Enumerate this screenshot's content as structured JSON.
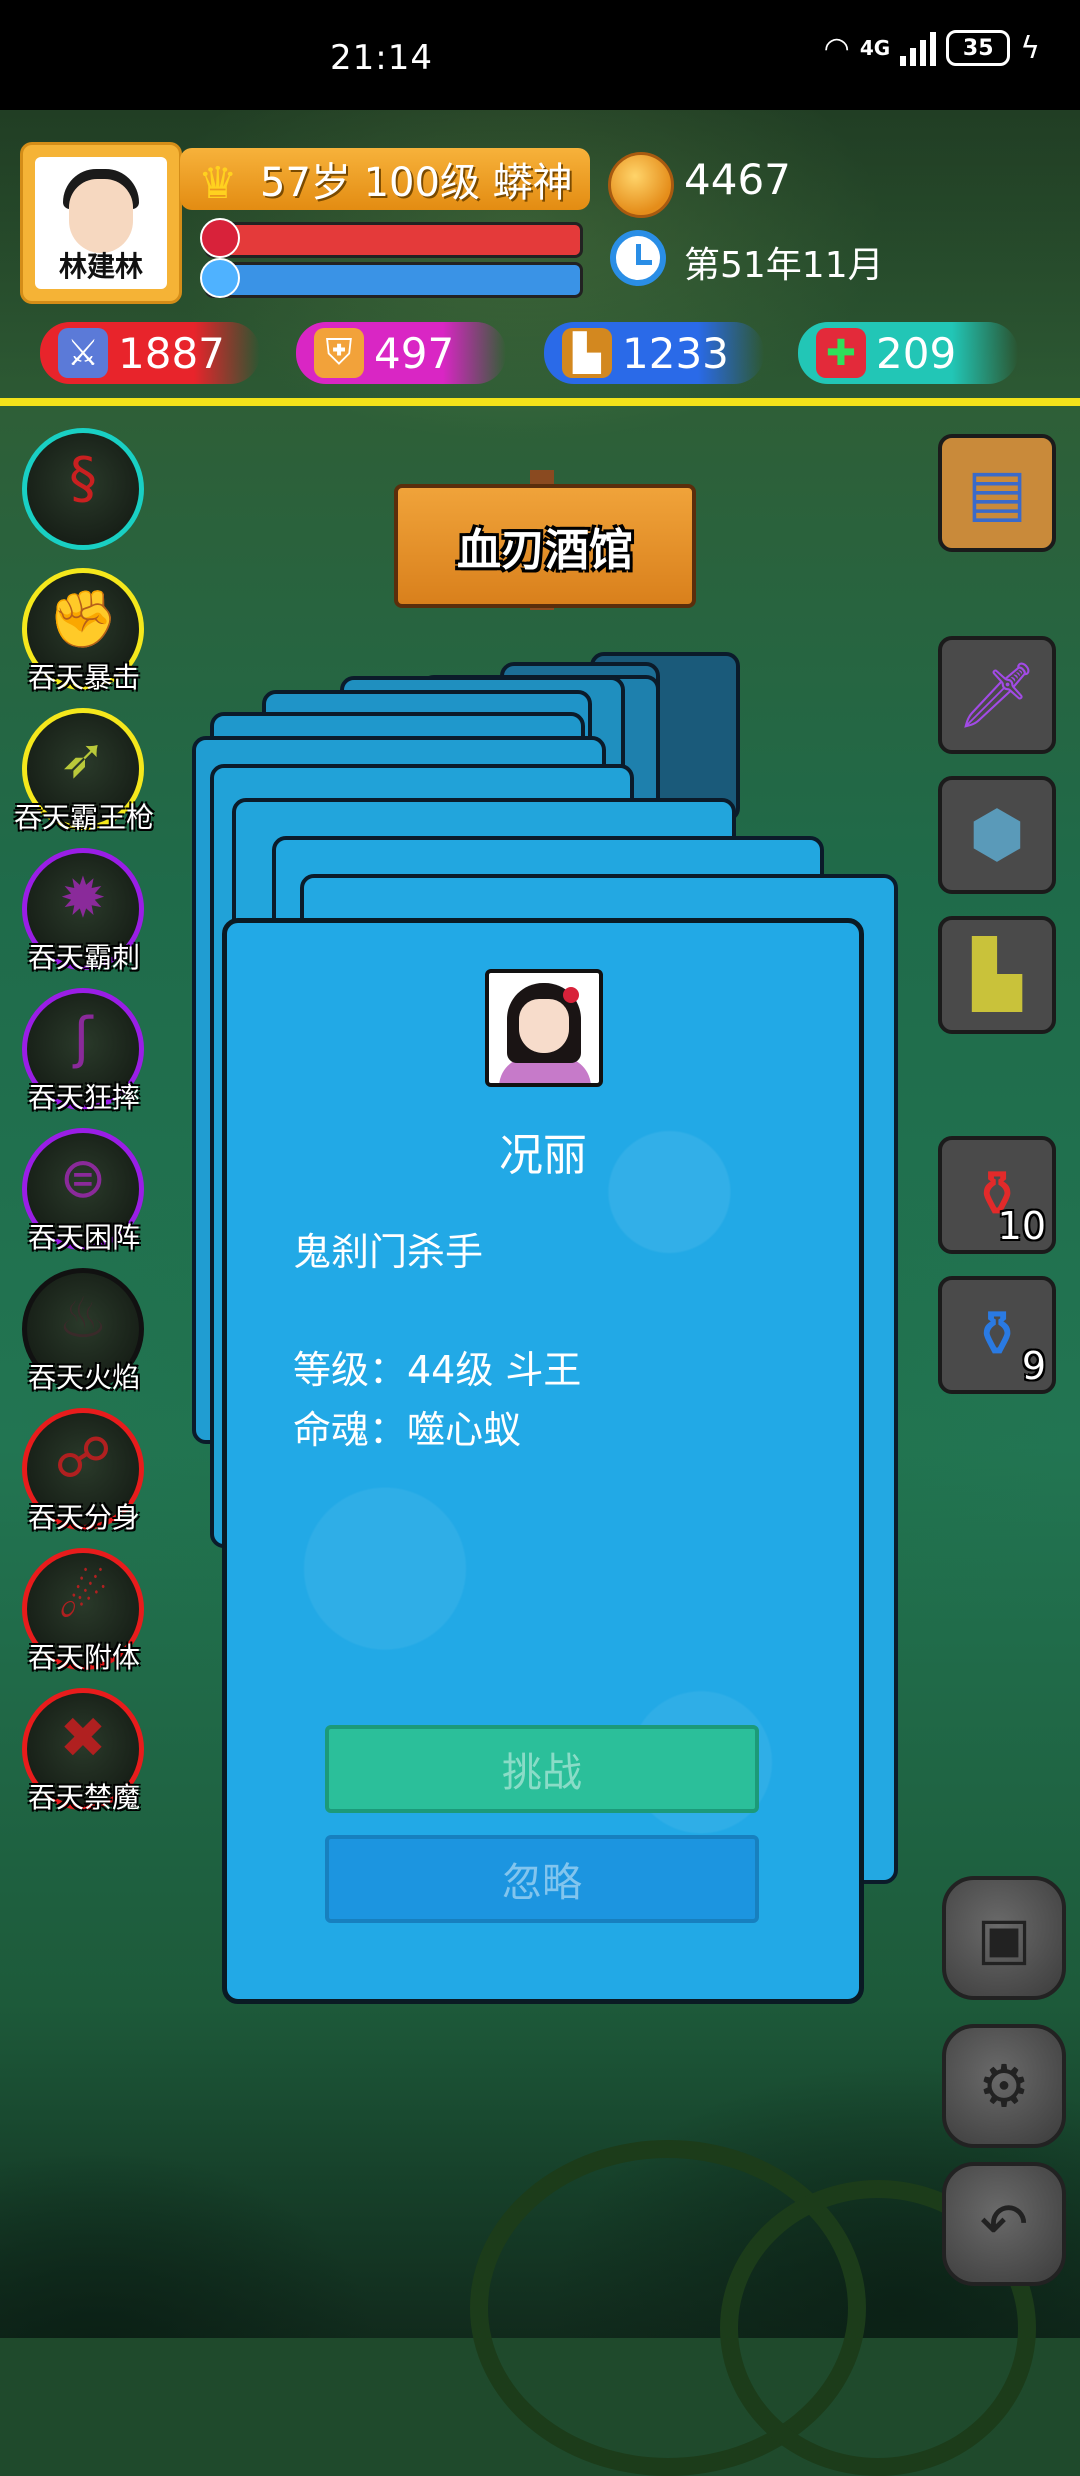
{
  "status_bar": {
    "time": "21:14",
    "network": "4G",
    "battery": "35"
  },
  "player": {
    "name": "林建林",
    "level_text": "57岁 100级 蟒神",
    "gold": "4467",
    "date": "第51年11月",
    "hp_fill": 1.0,
    "mp_fill": 1.0
  },
  "stats": {
    "attack": "1887",
    "defense": "497",
    "speed": "1233",
    "health": "209"
  },
  "location": {
    "name": "血刃酒馆"
  },
  "skills": [
    {
      "label": "",
      "color": "#19d0c4"
    },
    {
      "label": "吞天暴击",
      "color": "#f5e81c"
    },
    {
      "label": "吞天霸王枪",
      "color": "#f5e81c"
    },
    {
      "label": "吞天霸刺",
      "color": "#9a1ee6"
    },
    {
      "label": "吞天狂摔",
      "color": "#9a1ee6"
    },
    {
      "label": "吞天困阵",
      "color": "#9a1ee6"
    },
    {
      "label": "吞天火焰",
      "color": "#111111"
    },
    {
      "label": "吞天分身",
      "color": "#e81c1c"
    },
    {
      "label": "吞天附体",
      "color": "#e81c1c"
    },
    {
      "label": "吞天禁魔",
      "color": "#e81c1c"
    }
  ],
  "inventory": {
    "red_potion_count": "10",
    "blue_potion_count": "9"
  },
  "encounter": {
    "npc_name": "况丽",
    "npc_title": "鬼刹门杀手",
    "level_line": "等级：44级 斗王",
    "soul_line": "命魂：噬心蚁",
    "challenge_label": "挑战",
    "ignore_label": "忽略"
  }
}
